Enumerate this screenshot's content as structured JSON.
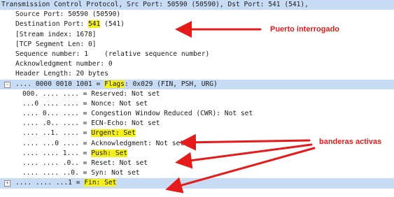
{
  "header": {
    "text": "Transmission Control Protocol, Src Port: 50590 (50590), Dst Port: 541 (541),"
  },
  "fields": {
    "source_port": "Source Port: 50590 (50590)",
    "dest_port_prefix": "Destination Port: ",
    "dest_port_value": "541",
    "dest_port_suffix": " (541)",
    "stream_index": "[Stream index: 1678]",
    "segment_len": "[TCP Segment Len: 0]",
    "seq": "Sequence number: 1    (relative sequence number)",
    "ack": "Acknowledgment number: 0",
    "hdr_len": "Header Length: 20 bytes"
  },
  "flags": {
    "row_prefix": ".... 0000 0010 1001 = ",
    "row_label": "Flags",
    "row_suffix": ": 0x029 (FIN, PSH, URG)",
    "reserved": "000. .... .... = Reserved: Not set",
    "nonce": "...0 .... .... = Nonce: Not set",
    "cwr": ".... 0... .... = Congestion Window Reduced (CWR): Not set",
    "ecn": ".... .0.. .... = ECN-Echo: Not set",
    "urgent_prefix": ".... ..1. .... = ",
    "urgent_label": "Urgent: Set",
    "ack_prefix": ".... ...0 .... = ",
    "ack_label": "Acknowledgment",
    "ack_suffix": ": Not set",
    "push_prefix": ".... .... 1... = ",
    "push_label": "Push: Set",
    "reset": ".... .... .0.. = Reset: Not set",
    "syn": ".... .... ..0. = Syn: Not set",
    "fin_prefix": ".... .... ...1 = ",
    "fin_label": "Fin: Set"
  },
  "annotations": {
    "port": "Puerto interrogado",
    "flags": "banderas activas",
    "color": "#e51b1b"
  },
  "colors": {
    "selection": "#c7dbf5",
    "highlight": "#f5ef1c"
  }
}
